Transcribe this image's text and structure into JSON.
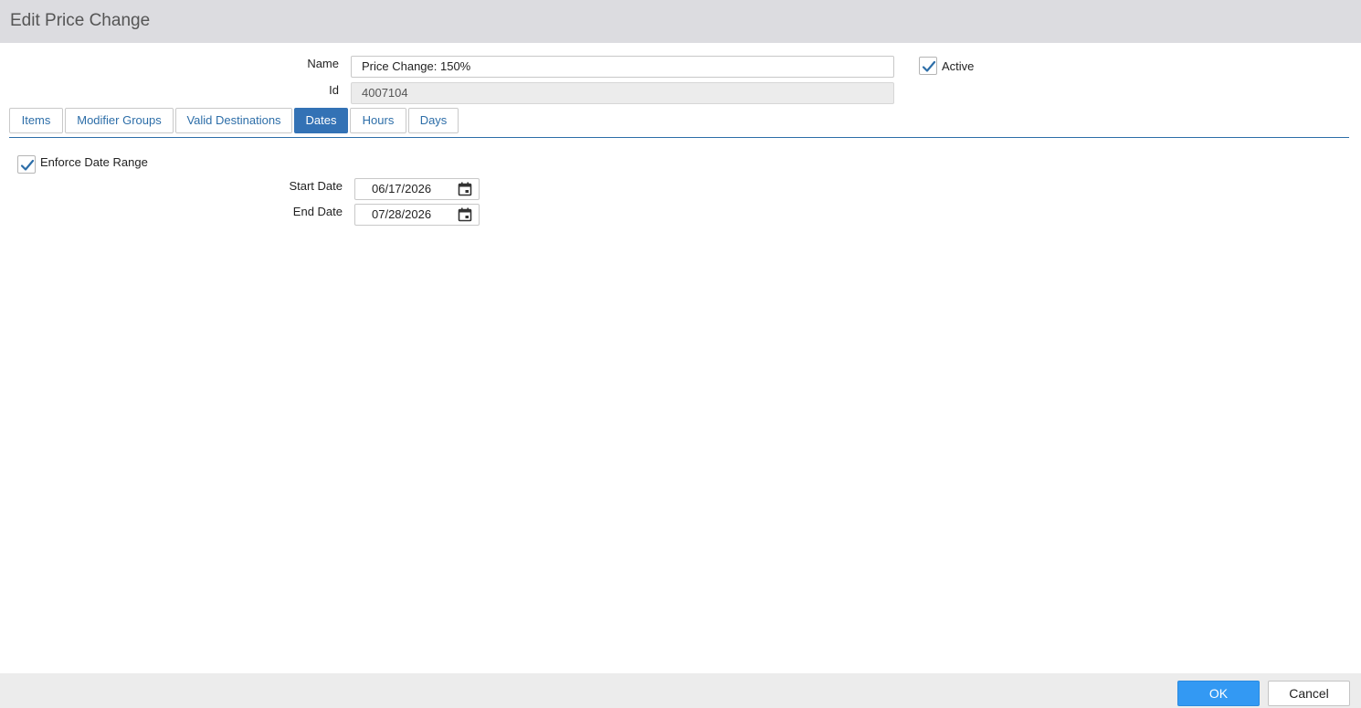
{
  "dialog": {
    "title": "Edit Price Change"
  },
  "form": {
    "name_label": "Name",
    "name_value": "Price Change: 150%",
    "id_label": "Id",
    "id_value": "4007104",
    "active_label": "Active",
    "active_checked": true
  },
  "tabs": [
    {
      "label": "Items",
      "active": false
    },
    {
      "label": "Modifier Groups",
      "active": false
    },
    {
      "label": "Valid Destinations",
      "active": false
    },
    {
      "label": "Dates",
      "active": true
    },
    {
      "label": "Hours",
      "active": false
    },
    {
      "label": "Days",
      "active": false
    }
  ],
  "dates": {
    "enforce_label": "Enforce Date Range",
    "enforce_checked": true,
    "start_label": "Start Date",
    "start_value": "06/17/2026",
    "end_label": "End Date",
    "end_value": "07/28/2026"
  },
  "footer": {
    "ok_label": "OK",
    "cancel_label": "Cancel"
  },
  "colors": {
    "accent": "#3372b5",
    "ok_button": "#3399f3",
    "title_bar": "#dcdce0"
  },
  "icons": {
    "checkbox_check": "check-icon",
    "date_picker": "calendar-icon"
  }
}
